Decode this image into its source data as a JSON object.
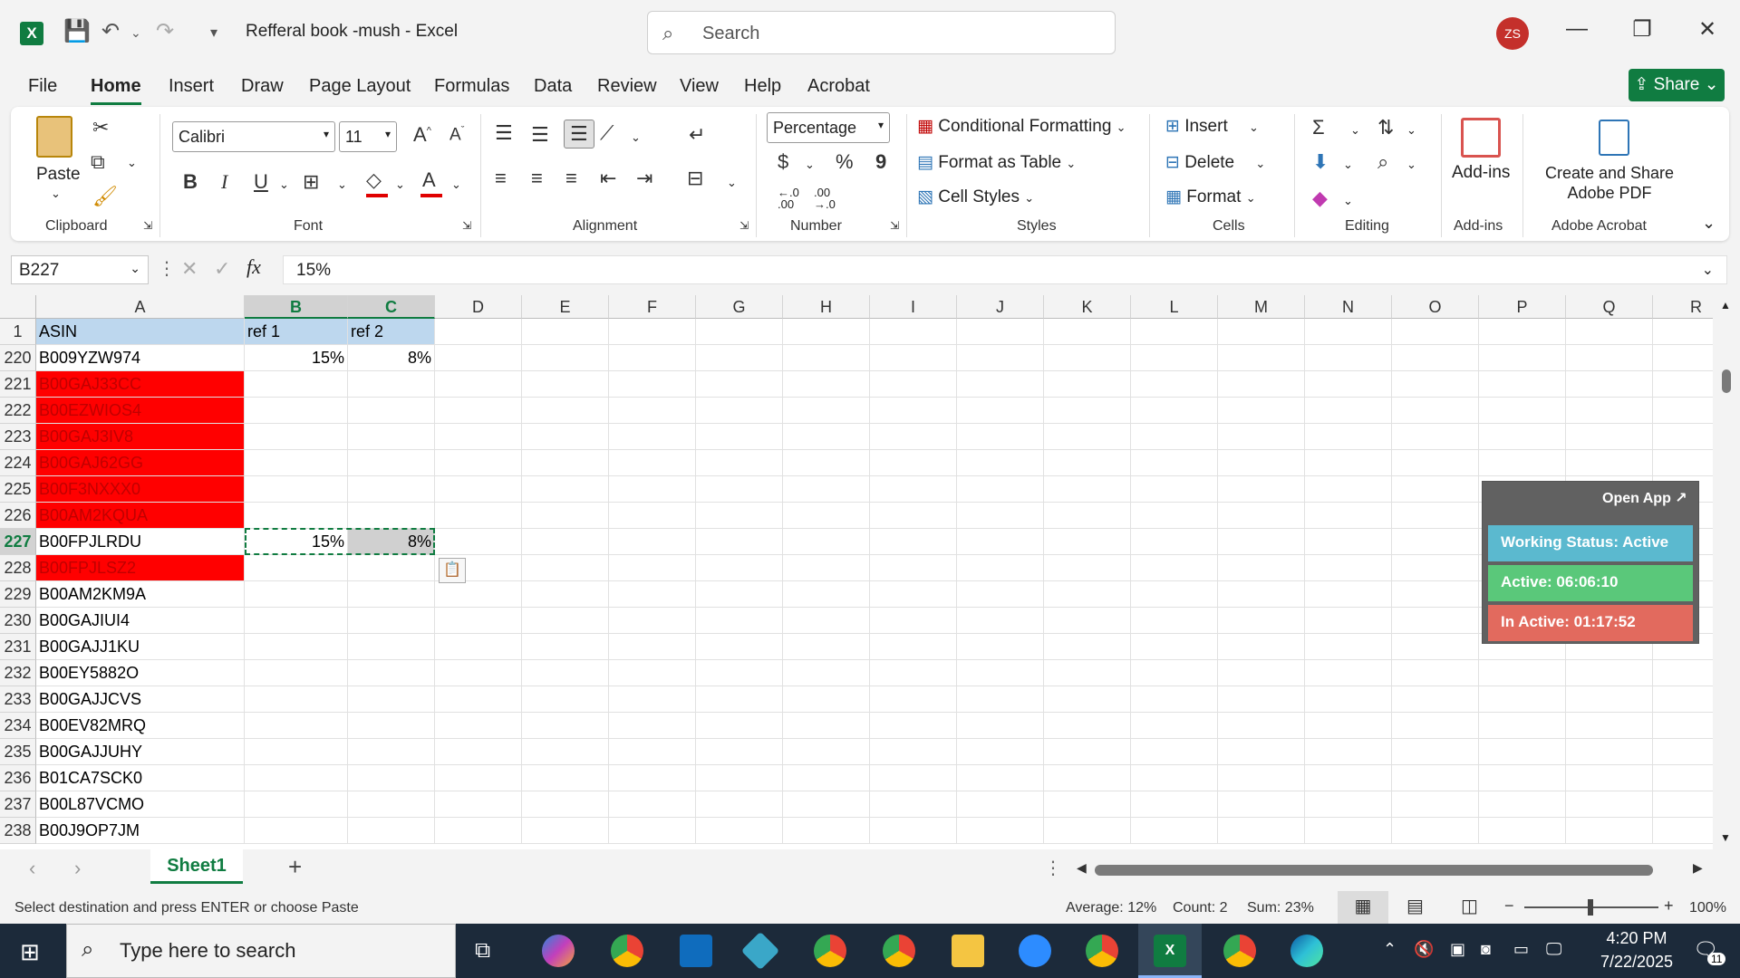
{
  "titlebar": {
    "doc_title": "Refferal book -mush  -  Excel",
    "search_placeholder": "Search",
    "avatar": "ZS"
  },
  "menu": {
    "tabs": [
      "File",
      "Home",
      "Insert",
      "Draw",
      "Page Layout",
      "Formulas",
      "Data",
      "Review",
      "View",
      "Help",
      "Acrobat"
    ],
    "active": "Home",
    "share": "Share"
  },
  "ribbon": {
    "clipboard": {
      "label": "Clipboard",
      "paste": "Paste"
    },
    "font": {
      "label": "Font",
      "name": "Calibri",
      "size": "11",
      "bold": "B",
      "italic": "I",
      "underline": "U"
    },
    "alignment": {
      "label": "Alignment"
    },
    "number": {
      "label": "Number",
      "format": "Percentage",
      "currency": "$",
      "percent": "%",
      "comma": "9",
      "inc_decimal": "←.0\n.00",
      "dec_decimal": ".00\n→.0"
    },
    "styles": {
      "label": "Styles",
      "conditional": "Conditional Formatting",
      "format_table": "Format as Table",
      "cell_styles": "Cell Styles"
    },
    "cells": {
      "label": "Cells",
      "insert": "Insert",
      "delete": "Delete",
      "format": "Format"
    },
    "editing": {
      "label": "Editing"
    },
    "addins": {
      "label": "Add-ins",
      "btn": "Add-ins"
    },
    "acrobat": {
      "label": "Adobe Acrobat",
      "btn_line1": "Create and Share",
      "btn_line2": "Adobe PDF"
    }
  },
  "formula_bar": {
    "name_box": "B227",
    "value": "15%",
    "fx": "fx"
  },
  "columns": [
    "A",
    "B",
    "C",
    "D",
    "E",
    "F",
    "G",
    "H",
    "I",
    "J",
    "K",
    "L",
    "M",
    "N",
    "O",
    "P",
    "Q",
    "R"
  ],
  "header_row": {
    "num": "1",
    "a": "ASIN",
    "b": "ref 1",
    "c": "ref 2"
  },
  "rows": [
    {
      "num": "220",
      "a": "B009YZW974",
      "b": "15%",
      "c": "8%",
      "red": false
    },
    {
      "num": "221",
      "a": "B00GAJ33CC",
      "b": "",
      "c": "",
      "red": true
    },
    {
      "num": "222",
      "a": "B00EZWIOS4",
      "b": "",
      "c": "",
      "red": true
    },
    {
      "num": "223",
      "a": "B00GAJ3IV8",
      "b": "",
      "c": "",
      "red": true
    },
    {
      "num": "224",
      "a": "B00GAJ62GG",
      "b": "",
      "c": "",
      "red": true
    },
    {
      "num": "225",
      "a": "B00F3NXXX0",
      "b": "",
      "c": "",
      "red": true
    },
    {
      "num": "226",
      "a": "B00AM2KQUA",
      "b": "",
      "c": "",
      "red": true
    },
    {
      "num": "227",
      "a": "B00FPJLRDU",
      "b": "15%",
      "c": "8%",
      "red": false
    },
    {
      "num": "228",
      "a": "B00FPJLSZ2",
      "b": "",
      "c": "",
      "red": true
    },
    {
      "num": "229",
      "a": "B00AM2KM9A",
      "b": "",
      "c": "",
      "red": false
    },
    {
      "num": "230",
      "a": "B00GAJIUI4",
      "b": "",
      "c": "",
      "red": false
    },
    {
      "num": "231",
      "a": "B00GAJJ1KU",
      "b": "",
      "c": "",
      "red": false
    },
    {
      "num": "232",
      "a": "B00EY5882O",
      "b": "",
      "c": "",
      "red": false
    },
    {
      "num": "233",
      "a": "B00GAJJCVS",
      "b": "",
      "c": "",
      "red": false
    },
    {
      "num": "234",
      "a": "B00EV82MRQ",
      "b": "",
      "c": "",
      "red": false
    },
    {
      "num": "235",
      "a": "B00GAJJUHY",
      "b": "",
      "c": "",
      "red": false
    },
    {
      "num": "236",
      "a": "B01CA7SCK0",
      "b": "",
      "c": "",
      "red": false
    },
    {
      "num": "237",
      "a": "B00L87VCMO",
      "b": "",
      "c": "",
      "red": false
    },
    {
      "num": "238",
      "a": "B00J9OP7JM",
      "b": "",
      "c": "",
      "red": false
    }
  ],
  "widget": {
    "open_app": "Open App ↗",
    "working_status": "Working Status: Active",
    "active": "Active: 06:06:10",
    "inactive": "In Active: 01:17:52",
    "colors": {
      "status": "#5bb9cf",
      "active": "#5ac87a",
      "inactive": "#e26a5e"
    }
  },
  "sheetbar": {
    "sheet_name": "Sheet1",
    "add": "+"
  },
  "statusbar": {
    "message": "Select destination and press ENTER or choose Paste",
    "average": "Average: 12%",
    "count": "Count: 2",
    "sum": "Sum: 23%",
    "zoom": "100%"
  },
  "taskbar": {
    "search_placeholder": "Type here to search",
    "time": "4:20 PM",
    "date": "7/22/2025",
    "notif_count": "11"
  },
  "colors": {
    "excel_green": "#107c41",
    "red_fill": "#ff0000",
    "header_blue": "#bdd7ee"
  }
}
